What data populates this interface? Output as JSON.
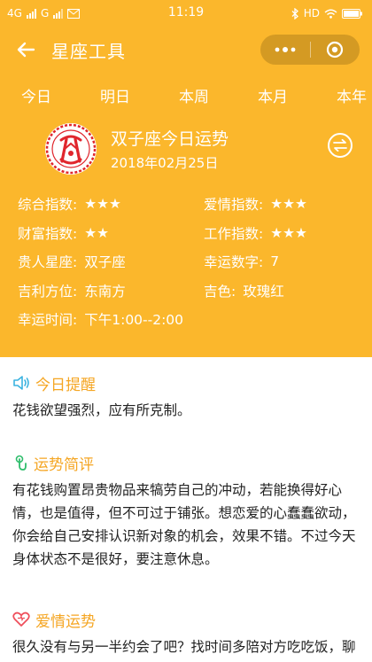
{
  "status_bar": {
    "network_left": "4G",
    "network_right": "G",
    "time": "11:19",
    "hd_label": "HD"
  },
  "header": {
    "title": "星座工具"
  },
  "tabs": [
    {
      "label": "今日"
    },
    {
      "label": "明日"
    },
    {
      "label": "本周"
    },
    {
      "label": "本月"
    },
    {
      "label": "本年"
    }
  ],
  "fortune_card": {
    "title": "双子座今日运势",
    "date": "2018年02月25日",
    "items": [
      {
        "label": "综合指数:",
        "value": "★★★"
      },
      {
        "label": "爱情指数:",
        "value": "★★★"
      },
      {
        "label": "财富指数:",
        "value": "★★"
      },
      {
        "label": "工作指数:",
        "value": "★★★"
      },
      {
        "label": "贵人星座:",
        "value": "双子座"
      },
      {
        "label": "幸运数字:",
        "value": "7"
      },
      {
        "label": "吉利方位:",
        "value": "东南方"
      },
      {
        "label": "吉色:",
        "value": "玫瑰红"
      }
    ],
    "lucky_time": {
      "label": "幸运时间:",
      "value": "下午1:00--2:00"
    }
  },
  "sections": {
    "reminder": {
      "title": "今日提醒",
      "text": "花钱欲望强烈，应有所克制。"
    },
    "summary": {
      "title": "运势简评",
      "text": "有花钱购置昂贵物品来犒劳自己的冲动，若能换得好心情，也是值得，但不可过于铺张。想恋爱的心蠢蠢欲动，你会给自己安排认识新对象的机会，效果不错。不过今天身体状态不是很好，要注意休息。"
    },
    "love": {
      "title": "爱情运势",
      "text": "很久没有与另一半约会了吧？找时间多陪对方吃吃饭，聊聊心事吧！"
    }
  },
  "colors": {
    "accent": "#fbb72c",
    "section_title": "#f5a623",
    "logo_red": "#e0262d"
  }
}
